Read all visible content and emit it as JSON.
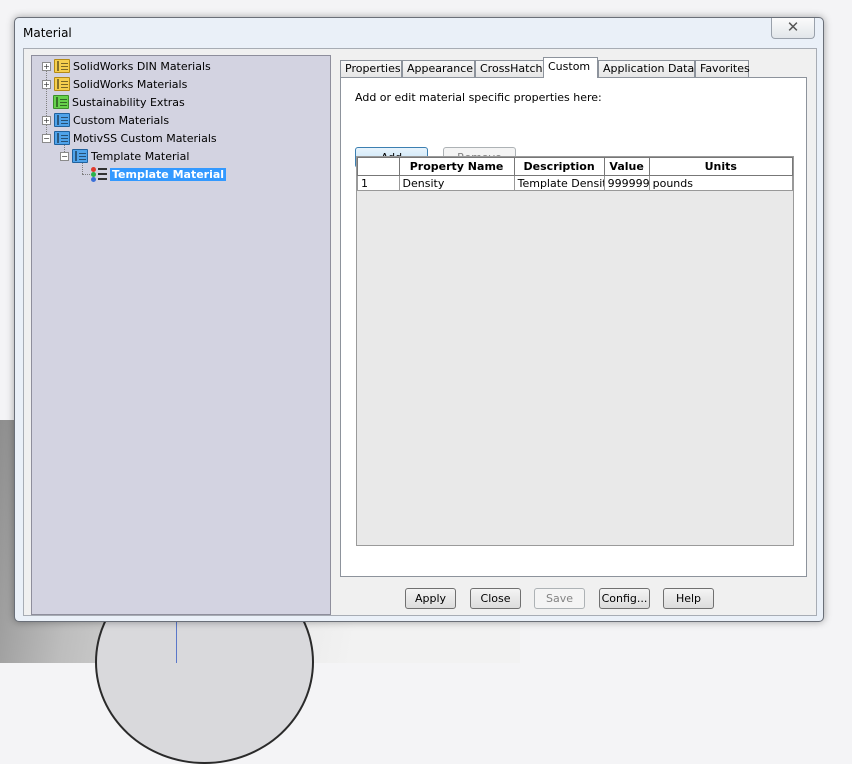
{
  "window": {
    "title": "Material",
    "close_glyph": "✕"
  },
  "tree": {
    "items": [
      {
        "label": "SolidWorks DIN Materials",
        "icon": "yellow-book-icon",
        "expander": "+"
      },
      {
        "label": "SolidWorks Materials",
        "icon": "yellow-book-icon",
        "expander": "+"
      },
      {
        "label": "Sustainability Extras",
        "icon": "green-book-icon",
        "expander": ""
      },
      {
        "label": "Custom Materials",
        "icon": "blue-book-icon",
        "expander": "+"
      },
      {
        "label": "MotivSS Custom Materials",
        "icon": "blue-book-icon",
        "expander": "−"
      },
      {
        "label": "Template Material",
        "icon": "blue-book-icon",
        "expander": "−"
      },
      {
        "label": "Template Material",
        "icon": "material-icon",
        "expander": "",
        "selected": true
      }
    ]
  },
  "tabs": [
    "Properties",
    "Appearance",
    "CrossHatch",
    "Custom",
    "Application Data",
    "Favorites"
  ],
  "active_tab": "Custom",
  "custom": {
    "hint": "Add or edit material specific properties here:",
    "add_label": "Add",
    "remove_label": "Remove",
    "columns": [
      "",
      "Property Name",
      "Description",
      "Value",
      "Units"
    ],
    "rows": [
      [
        "1",
        "Density",
        "Template Densit",
        "999999",
        "pounds"
      ]
    ]
  },
  "buttons": {
    "apply": "Apply",
    "close": "Close",
    "save": "Save",
    "config": "Config...",
    "help": "Help"
  },
  "colors": {
    "selection": "#3399ff",
    "tree_bg": "#d3d3e1"
  }
}
